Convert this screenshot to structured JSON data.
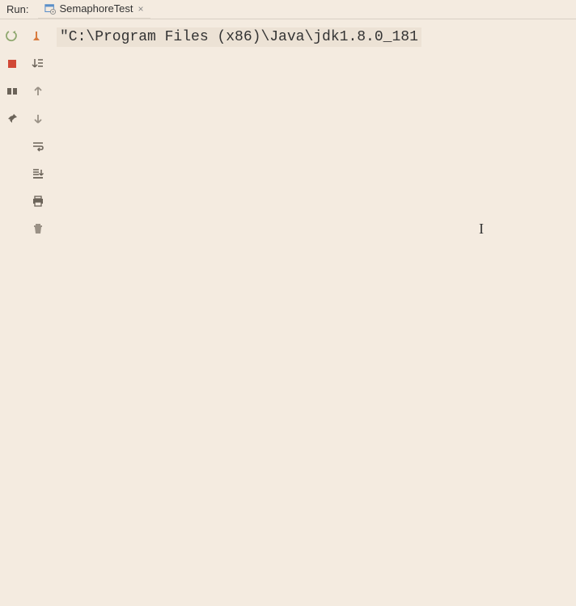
{
  "header": {
    "run_label": "Run:",
    "tab": {
      "label": "SemaphoreTest",
      "close_symbol": "×"
    }
  },
  "console": {
    "line1": "\"C:\\Program Files (x86)\\Java\\jdk1.8.0_181"
  },
  "icons": {
    "rerun": "rerun",
    "stop": "stop",
    "layout": "layout",
    "pin": "pin",
    "exit": "exit",
    "track": "track",
    "up": "up",
    "down": "down",
    "wrap": "wrap",
    "scroll": "scroll",
    "print": "print",
    "trash": "trash"
  }
}
